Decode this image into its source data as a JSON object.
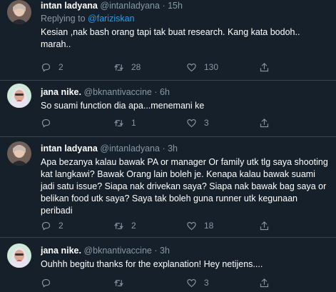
{
  "tweets": [
    {
      "name": "intan ladyana",
      "handle": "@intanladyana",
      "sep": "·",
      "time": "15h",
      "reply_prefix": "Replying to",
      "reply_to": "@fariziskan",
      "text": "Kesian ,nak bash orang tapi tak buat research. Kang kata bodoh.. marah..",
      "replies": "2",
      "retweets": "28",
      "likes": "130"
    },
    {
      "name": "jana nike.",
      "handle": "@bknantivaccine",
      "sep": "·",
      "time": "6h",
      "text": "So suami function dia apa...menemani ke",
      "replies": "",
      "retweets": "1",
      "likes": "3"
    },
    {
      "name": "intan ladyana",
      "handle": "@intanladyana",
      "sep": "·",
      "time": "3h",
      "text": "Apa bezanya kalau bawak PA or manager Or family utk tlg saya shooting kat langkawi? Bawak Orang lain boleh je. Kenapa kalau bawak suami jadi satu issue? Siapa nak drivekan saya? Siapa nak bawak bag saya or belikan food utk saya? Saya tak boleh guna runner utk kegunaan peribadi",
      "replies": "2",
      "retweets": "2",
      "likes": "18"
    },
    {
      "name": "jana nike.",
      "handle": "@bknantivaccine",
      "sep": "·",
      "time": "3h",
      "text": "Ouhhh begitu thanks for the explanation! Hey netijens....",
      "replies": "",
      "retweets": "",
      "likes": "3"
    }
  ],
  "icons": {
    "reply": "reply-icon",
    "retweet": "retweet-icon",
    "like": "like-icon",
    "share": "share-icon",
    "more": "more-icon"
  },
  "colors": {
    "background": "#15202b",
    "muted": "#8899a6",
    "link": "#1da1f2",
    "divider": "#38444d"
  }
}
